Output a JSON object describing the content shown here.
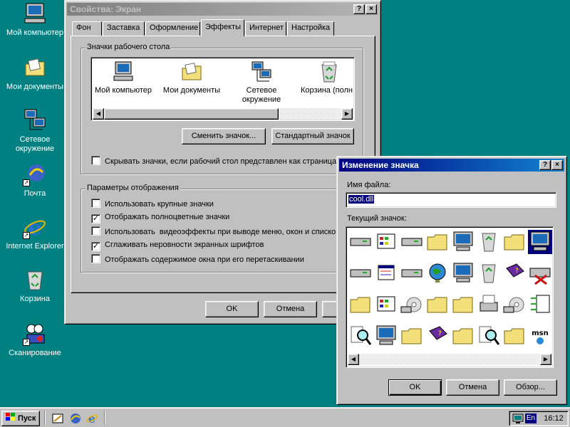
{
  "desktop": {
    "icons": [
      {
        "label": "Мой компьютер",
        "icon": "my-computer-icon"
      },
      {
        "label": "Мои документы",
        "icon": "my-documents-icon"
      },
      {
        "label": "Сетевое окружение",
        "icon": "network-neighborhood-icon"
      },
      {
        "label": "Почта",
        "icon": "mail-icon"
      },
      {
        "label": "Internet Explorer",
        "icon": "internet-explorer-icon"
      },
      {
        "label": "Корзина",
        "icon": "recycle-bin-icon"
      },
      {
        "label": "Сканирование",
        "icon": "scanner-icon"
      }
    ]
  },
  "display_props": {
    "title": "Свойства: Экран",
    "help_btn": "?",
    "close_btn": "×",
    "tabs": [
      "Фон",
      "Заставка",
      "Оформление",
      "Эффекты",
      "Интернет",
      "Настройка"
    ],
    "selected_tab": "Эффекты",
    "desktop_icons_group": "Значки рабочего стола",
    "icons": [
      {
        "label": "Мой компьютер",
        "icon": "my-computer-icon"
      },
      {
        "label": "Мои документы",
        "icon": "my-documents-icon"
      },
      {
        "label": "Сетевое окружение",
        "icon": "network-neighborhood-icon"
      },
      {
        "label": "Корзина (полн",
        "icon": "recycle-bin-full-icon"
      }
    ],
    "change_icon_btn": "Сменить значок...",
    "default_icon_btn": "Стандартный значок",
    "hide_icons_label": "Скрывать значки, если рабочий стол представлен как страница",
    "display_group": "Параметры отображения",
    "options": [
      {
        "label": "Использовать крупные значки",
        "checked": false
      },
      {
        "label": "Отображать полноцветные значки",
        "checked": true
      },
      {
        "label": "Использовать  видеоэффекты при выводе меню, окон и списко",
        "checked": false
      },
      {
        "label": "Сглаживать неровности экранных шрифтов",
        "checked": true
      },
      {
        "label": "Отображать содержимое окна при его перетаскивании",
        "checked": false
      }
    ],
    "ok_btn": "OK",
    "cancel_btn": "Отмена",
    "apply_btn": "Пр"
  },
  "change_icon": {
    "title": "Изменение значка",
    "help_btn": "?",
    "close_btn": "×",
    "file_name_label": "Имя файла:",
    "file_name_value": "cool.dll",
    "current_icon_label": "Текущий значок:",
    "ok_btn": "OK",
    "cancel_btn": "Отмена",
    "browse_btn": "Обзор...",
    "grid_icons": [
      [
        "drive-icon",
        "control-panel-icon",
        "hard-drive-icon",
        "network-folder-icon",
        "computer-icon",
        "recycle-bin-icon",
        "folder-apps-icon",
        "monitor-selected-icon"
      ],
      [
        "drive-icon",
        "window-list-icon",
        "floppy-drive-icon",
        "globe-icon",
        "network-computers-icon",
        "recycle-bin-full-icon",
        "help-book-icon",
        "disconnected-drive-icon"
      ],
      [
        "open-folder-icon",
        "settings-icon",
        "cd-drive-icon",
        "fonts-folder-icon",
        "folder-icon",
        "printer-icon",
        "audio-cd-icon",
        "network-wire-icon"
      ],
      [
        "find-document-icon",
        "monitor-icon",
        "folder-icon",
        "help-book-icon",
        "scanner-folder-icon",
        "search-icon",
        "printers-folder-icon",
        "msn-icon"
      ]
    ]
  },
  "taskbar": {
    "start_label": "Пуск",
    "quick_launch": [
      "desktop-icon",
      "outlook-icon",
      "internet-explorer-icon"
    ],
    "language": "En",
    "clock": "16:12"
  }
}
